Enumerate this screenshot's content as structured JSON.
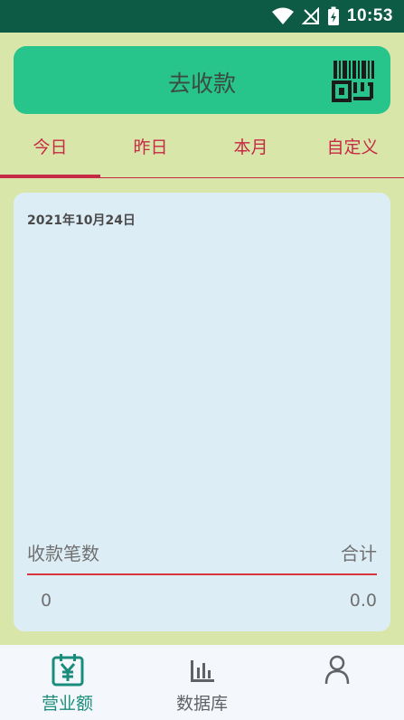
{
  "status_bar": {
    "time": "10:53",
    "icons": [
      "wifi-icon",
      "no-signal-icon",
      "battery-charging-icon"
    ]
  },
  "collect_button": {
    "label": "去收款",
    "icon": "barcode-scan-icon"
  },
  "tabs": [
    {
      "label": "今日",
      "active": true
    },
    {
      "label": "昨日",
      "active": false
    },
    {
      "label": "本月",
      "active": false
    },
    {
      "label": "自定义",
      "active": false
    }
  ],
  "summary_card": {
    "date": "2021年10月24日",
    "count_label": "收款笔数",
    "total_label": "合计",
    "count_value": "0",
    "total_value": "0.0"
  },
  "bottom_nav": [
    {
      "label": "营业额",
      "icon": "revenue-calendar-icon",
      "active": true
    },
    {
      "label": "数据库",
      "icon": "bar-chart-icon",
      "active": false
    },
    {
      "label": "",
      "icon": "person-icon",
      "active": false
    }
  ],
  "colors": {
    "status_bar": "#0d5a45",
    "page_background": "#d8e6a9",
    "collect_button": "#27c48c",
    "tab_accent": "#c62a44",
    "card_background": "#dcedf5",
    "divider": "#d8353c",
    "nav_active": "#1a8c7c",
    "nav_inactive": "#5f6368"
  }
}
